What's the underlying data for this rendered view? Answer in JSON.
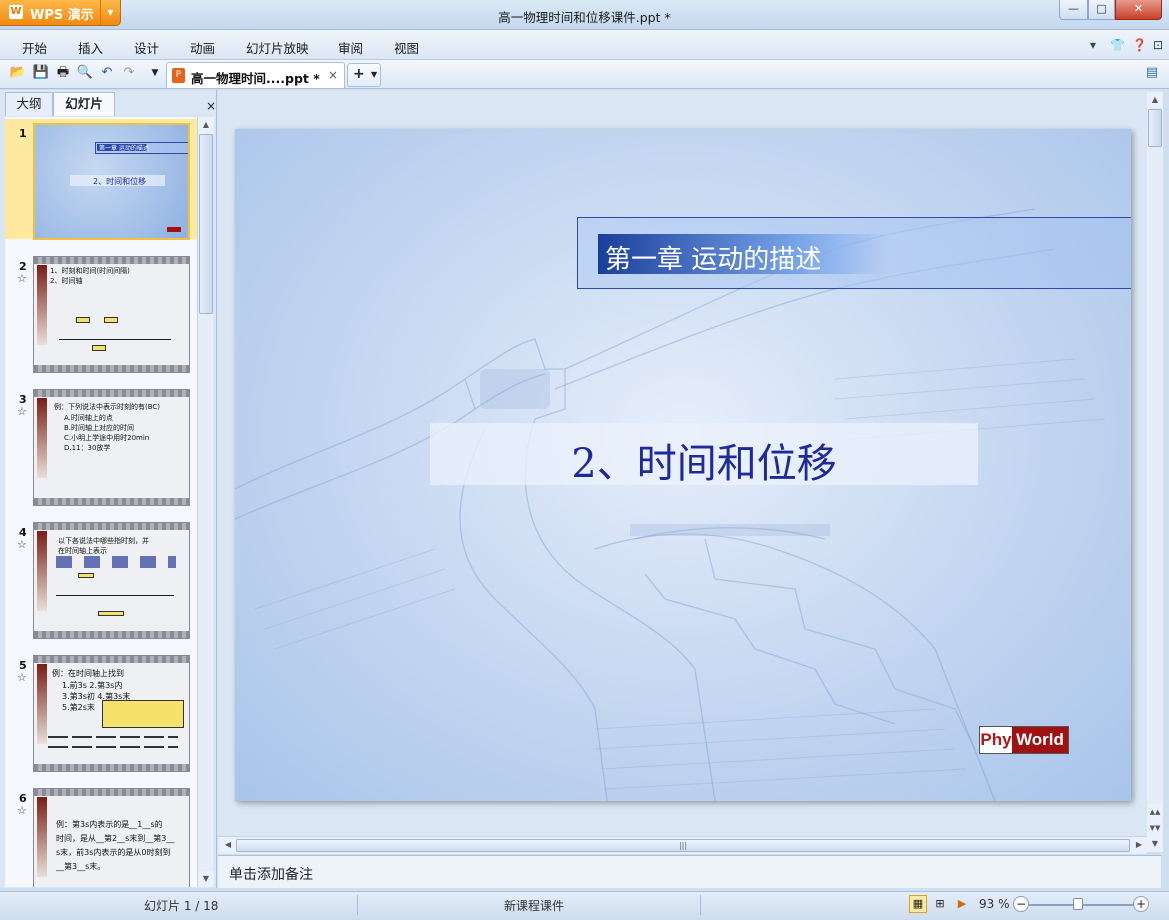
{
  "app": {
    "button": "WPS 演示",
    "title": "高一物理时间和位移课件.ppt *"
  },
  "menu": [
    "开始",
    "插入",
    "设计",
    "动画",
    "幻灯片放映",
    "审阅",
    "视图"
  ],
  "doc_tab": {
    "label": "高一物理时间....ppt *",
    "close": "×"
  },
  "panel": {
    "tabs": [
      "大纲",
      "幻灯片"
    ],
    "close": "×"
  },
  "thumbnails": [
    {
      "num": "1",
      "star": "",
      "lines": [
        "第一章 运动的描述",
        "2、时间和位移"
      ]
    },
    {
      "num": "2",
      "star": "☆",
      "lines": [
        "1、时刻和时间(时间间隔)",
        "2、时间轴"
      ]
    },
    {
      "num": "3",
      "star": "☆",
      "lines": [
        "例：下列说法中表示时刻的有(BC)",
        "A.时间轴上的点",
        "B.时间轴上对应的时间",
        "C.小明上学途中用时20min",
        "D.11：30放学"
      ]
    },
    {
      "num": "4",
      "star": "☆",
      "lines": [
        "以下各说法中哪些指时刻，并",
        "在时间轴上表示"
      ]
    },
    {
      "num": "5",
      "star": "☆",
      "lines": [
        "例：在时间轴上找到",
        "1.前3s    2.第3s内",
        "3.第3s初    4.第3s末",
        "5.第2s末"
      ]
    },
    {
      "num": "6",
      "star": "☆",
      "lines": [
        "例：第3s内表示的是__1__s的",
        "时间，是从__第2__s末到__第3__",
        "s末，前3s内表示的是从0时刻到",
        "__第3__s末。"
      ]
    }
  ],
  "slide": {
    "chapter": "第一章   运动的描述",
    "title": "2、时间和位移",
    "logo_a": "Phy",
    "logo_b": "World"
  },
  "notes": "单击添加备注",
  "status": {
    "slide": "幻灯片 1 / 18",
    "template": "新课程课件",
    "zoom": "93 %"
  }
}
